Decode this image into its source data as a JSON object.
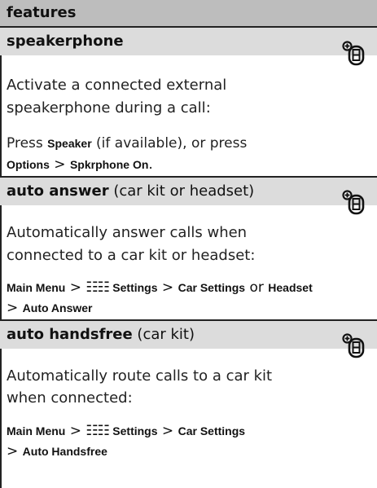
{
  "header": {
    "title": "features"
  },
  "sections": [
    {
      "title_bold": "speakerphone",
      "title_rest": "",
      "icon": "phone-feature-icon",
      "desc_line1": "Activate a connected external",
      "desc_line2": "speakerphone during a call:",
      "instr": {
        "press1": "Press ",
        "speaker": "Speaker",
        "mid": " (if available), or press",
        "options": "Options",
        "gt": " > ",
        "sprk": "Spkrphone On",
        "end": "."
      }
    },
    {
      "title_bold": "auto answer",
      "title_rest": " (car kit or headset)",
      "icon": "phone-feature-icon",
      "desc_line1": "Automatically answer calls when",
      "desc_line2": "connected to a car kit or headset:",
      "path": {
        "main_menu": "Main Menu",
        "gt1": " > ",
        "settings": "Settings",
        "gt2": " > ",
        "car_settings": "Car Settings",
        "or": " or ",
        "headset": "Headset",
        "gt3": "> ",
        "auto_answer": "Auto Answer"
      }
    },
    {
      "title_bold": "auto handsfree",
      "title_rest": " (car kit)",
      "icon": "phone-feature-icon",
      "desc_line1": "Automatically route calls to a car kit",
      "desc_line2": "when connected:",
      "path": {
        "main_menu": "Main Menu",
        "gt1": " > ",
        "settings": "Settings",
        "gt2": " > ",
        "car_settings": "Car Settings",
        "gt3": "> ",
        "auto_handsfree": "Auto Handsfree"
      }
    }
  ]
}
